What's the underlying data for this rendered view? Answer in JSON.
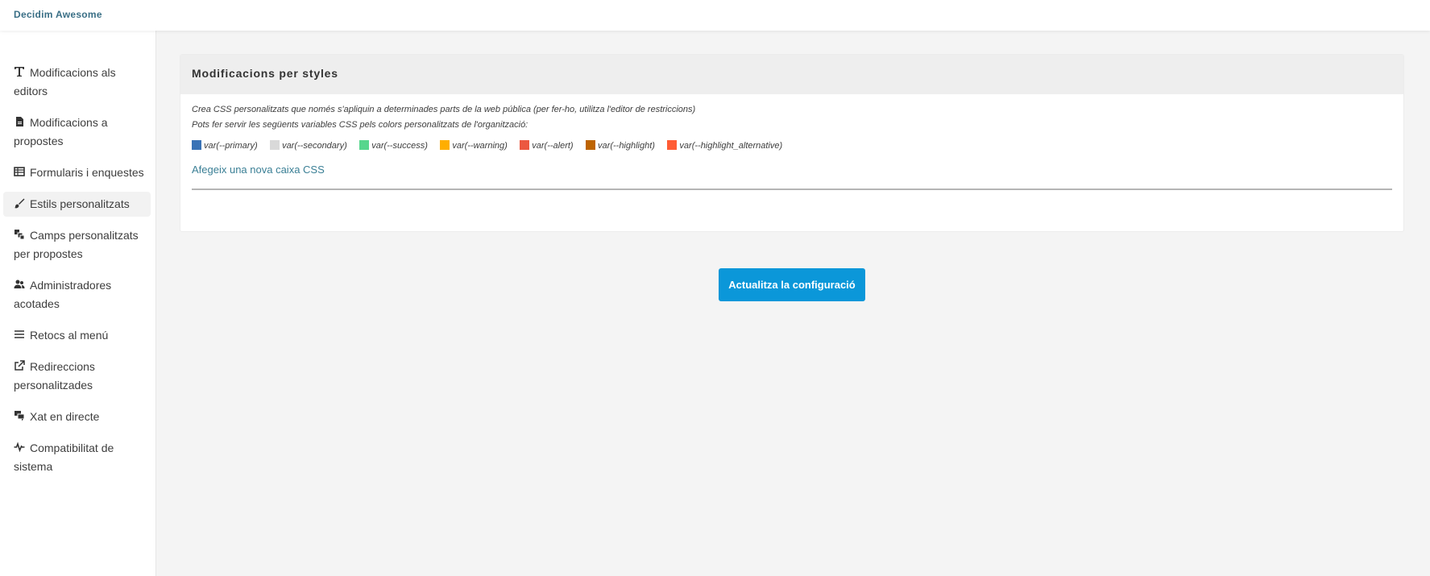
{
  "app": {
    "brand": "Decidim Awesome"
  },
  "sidebar": {
    "items": [
      {
        "label": "Modificacions als editors",
        "icon": "text-icon",
        "active": false
      },
      {
        "label": "Modificacions a propostes",
        "icon": "document-icon",
        "active": false
      },
      {
        "label": "Formularis i enquestes",
        "icon": "table-icon",
        "active": false
      },
      {
        "label": "Estils personalitzats",
        "icon": "brush-icon",
        "active": true
      },
      {
        "label": "Camps personalitzats per propostes",
        "icon": "layers-icon",
        "active": false
      },
      {
        "label": "Administradores acotades",
        "icon": "users-icon",
        "active": false
      },
      {
        "label": "Retocs al menú",
        "icon": "menu-icon",
        "active": false
      },
      {
        "label": "Redireccions personalitzades",
        "icon": "external-link-icon",
        "active": false
      },
      {
        "label": "Xat en directe",
        "icon": "chat-icon",
        "active": false
      },
      {
        "label": "Compatibilitat de sistema",
        "icon": "pulse-icon",
        "active": false
      }
    ]
  },
  "card": {
    "title": "Modificacions per styles",
    "help_line1": "Crea CSS personalitzats que només s'apliquin a determinades parts de la web pública (per fer-ho, utilitza l'editor de restriccions)",
    "help_line2": "Pots fer servir les següents variables CSS pels colors personalitzats de l'organització:",
    "variables": [
      {
        "name": "var(--primary)",
        "color": "#3a73b6"
      },
      {
        "name": "var(--secondary)",
        "color": "#d9d9d9"
      },
      {
        "name": "var(--success)",
        "color": "#57d68d"
      },
      {
        "name": "var(--warning)",
        "color": "#ffae00"
      },
      {
        "name": "var(--alert)",
        "color": "#ec5840"
      },
      {
        "name": "var(--highlight)",
        "color": "#be6400"
      },
      {
        "name": "var(--highlight_alternative)",
        "color": "#ff5c35"
      }
    ],
    "add_link": "Afegeix una nova caixa CSS"
  },
  "actions": {
    "update_label": "Actualitza la configuració"
  },
  "colors": {
    "accent": "#0b97d9",
    "link": "#3a7f95",
    "brand": "#3a6f86"
  }
}
